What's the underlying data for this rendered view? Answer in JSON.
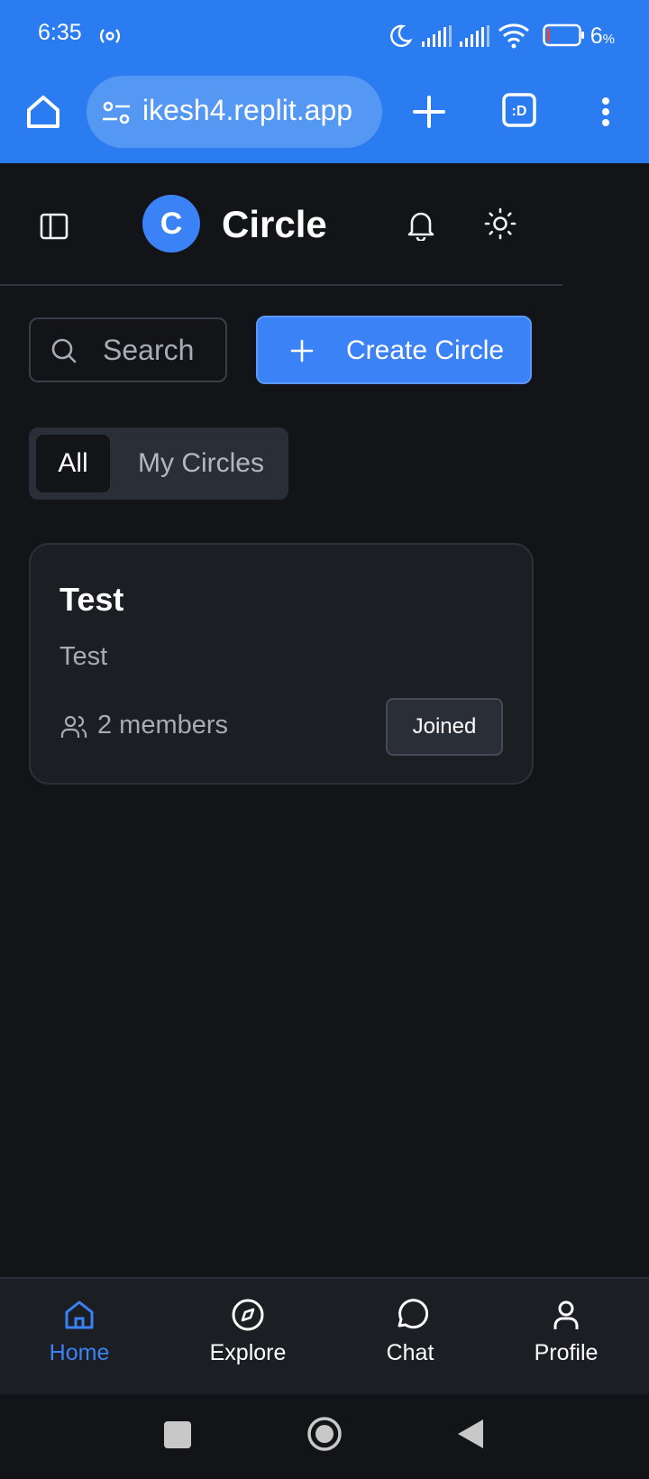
{
  "status_bar": {
    "time": "6:35",
    "battery": "6",
    "battery_unit": "%"
  },
  "browser": {
    "url": "ikesh4.replit.app",
    "tab_switcher_label": ":D",
    "toolbar_color": "#2a7cf0"
  },
  "header": {
    "logo_letter": "C",
    "title": "Circle",
    "accent": "#3b82f6"
  },
  "search": {
    "placeholder": "Search"
  },
  "create_button": {
    "label": "Create Circle"
  },
  "tabs": [
    {
      "label": "All",
      "active": true
    },
    {
      "label": "My Circles",
      "active": false
    }
  ],
  "circles": [
    {
      "title": "Test",
      "description": "Test",
      "members": "2 members",
      "status": "Joined"
    }
  ],
  "bottom_nav": [
    {
      "label": "Home",
      "icon": "home-icon",
      "active": true
    },
    {
      "label": "Explore",
      "icon": "compass-icon",
      "active": false
    },
    {
      "label": "Chat",
      "icon": "chat-bubble-icon",
      "active": false
    },
    {
      "label": "Profile",
      "icon": "user-icon",
      "active": false
    }
  ]
}
